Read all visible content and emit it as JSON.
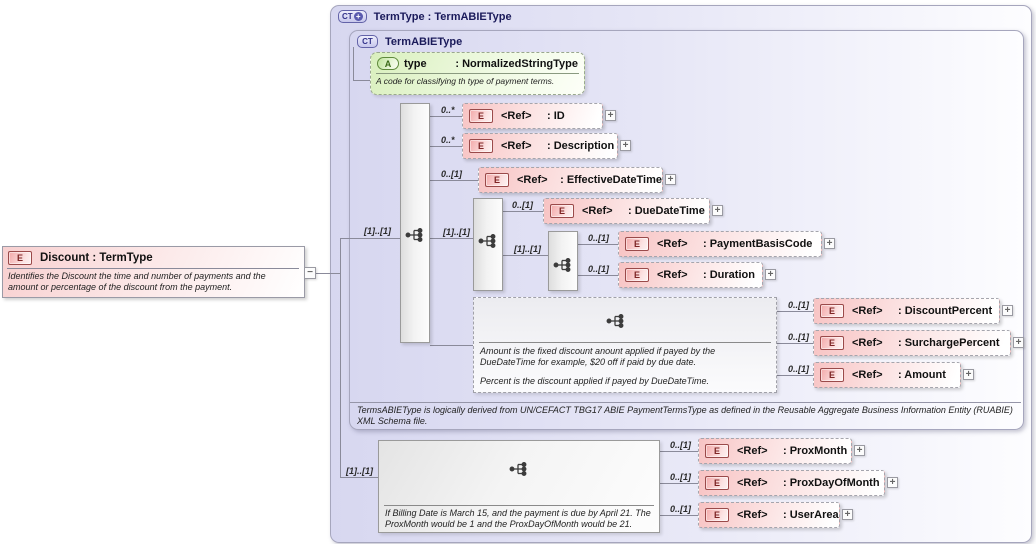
{
  "icons": {
    "expand": "+",
    "collapse": "−"
  },
  "root": {
    "badge": "E",
    "title": "Discount : TermType",
    "annotation": "Identifies the Discount the time and number of payments and the amount or percentage of the discount from the payment."
  },
  "outer": {
    "badge": "CT",
    "title": "TermType : TermABIEType"
  },
  "inner": {
    "badge": "CT",
    "title": "TermABIEType",
    "annotation": "TermsABIEType is logically derived from UN/CEFACT TBG17 ABIE PaymentTermsType as defined in the Reusable Aggregate Business Information Entity (RUABIE) XML Schema file."
  },
  "attribute": {
    "badge": "A",
    "name": "type",
    "type": ": NormalizedStringType",
    "annotation": "A code for classifying th type of payment terms."
  },
  "connector_labels": {
    "root_to_main_sequence": "[1]..[1]",
    "main_to_due_sequence": "[1]..[1]",
    "due_to_basis_sequence": "[1]..[1]",
    "root_to_prox_sequence": "[1]..[1]"
  },
  "refs": {
    "id": {
      "badge": "E",
      "label": "<Ref>",
      "type": ": ID",
      "cardinality": "0..*"
    },
    "description": {
      "badge": "E",
      "label": "<Ref>",
      "type": ": Description",
      "cardinality": "0..*"
    },
    "effective_date_time": {
      "badge": "E",
      "label": "<Ref>",
      "type": ": EffectiveDateTime",
      "cardinality": "0..[1]"
    },
    "due_date_time": {
      "badge": "E",
      "label": "<Ref>",
      "type": ": DueDateTime",
      "cardinality": "0..[1]"
    },
    "payment_basis_code": {
      "badge": "E",
      "label": "<Ref>",
      "type": ": PaymentBasisCode",
      "cardinality": "0..[1]"
    },
    "duration": {
      "badge": "E",
      "label": "<Ref>",
      "type": ": Duration",
      "cardinality": "0..[1]"
    },
    "discount_percent": {
      "badge": "E",
      "label": "<Ref>",
      "type": ": DiscountPercent",
      "cardinality": "0..[1]"
    },
    "surcharge_percent": {
      "badge": "E",
      "label": "<Ref>",
      "type": ": SurchargePercent",
      "cardinality": "0..[1]"
    },
    "amount": {
      "badge": "E",
      "label": "<Ref>",
      "type": ": Amount",
      "cardinality": "0..[1]"
    },
    "prox_month": {
      "badge": "E",
      "label": "<Ref>",
      "type": ": ProxMonth",
      "cardinality": "0..[1]"
    },
    "prox_day_of_month": {
      "badge": "E",
      "label": "<Ref>",
      "type": ": ProxDayOfMonth",
      "cardinality": "0..[1]"
    },
    "user_area": {
      "badge": "E",
      "label": "<Ref>",
      "type": ": UserArea",
      "cardinality": "0..[1]"
    }
  },
  "groups": {
    "discount": {
      "annotation1": "Amount is the fixed discount anount applied if payed by the DueDateTime for example, $20 off if paid by due date.",
      "annotation2": "Percent is the discount applied if payed by DueDateTime."
    },
    "prox": {
      "annotation": "If Billing Date is March 15, and the payment is due by April 21. The ProxMonth would be 1 and the ProxDayOfMonth would be 21."
    }
  }
}
